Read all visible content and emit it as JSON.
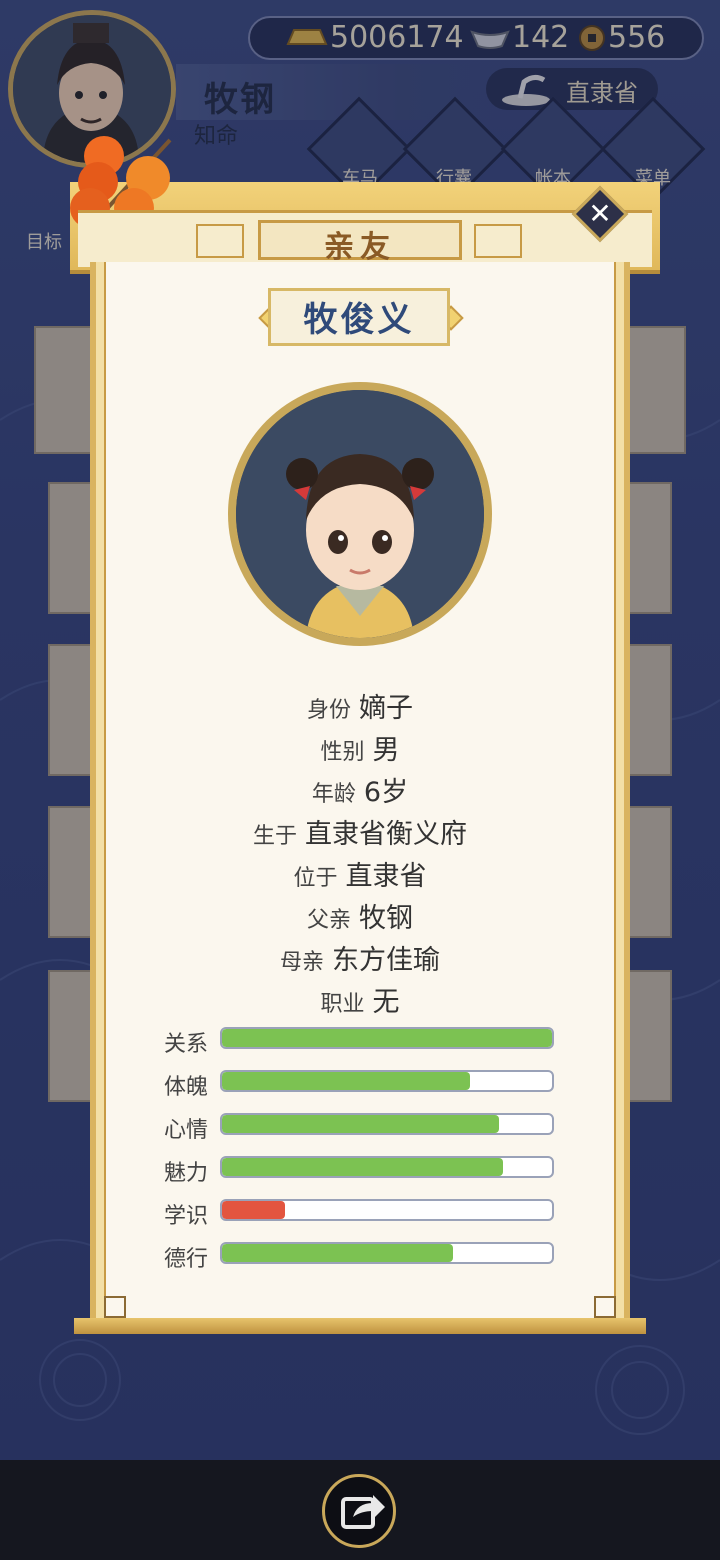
{
  "player": {
    "name": "牧钢",
    "title": "知命"
  },
  "currency": {
    "gold": "5006174",
    "silver": "142",
    "copper": "556"
  },
  "province": "直隶省",
  "menu": [
    {
      "label": "车马",
      "icon": "carriage-icon"
    },
    {
      "label": "行囊",
      "icon": "bag-icon"
    },
    {
      "label": "帐本",
      "icon": "ledger-icon"
    },
    {
      "label": "菜单",
      "icon": "more-icon"
    }
  ],
  "goal_label": "目标",
  "modal": {
    "title": "亲友",
    "child_name": "牧俊义",
    "info": [
      {
        "label": "身份",
        "value": "嫡子"
      },
      {
        "label": "性别",
        "value": "男"
      },
      {
        "label": "年龄",
        "value": "6岁"
      },
      {
        "label": "生于",
        "value": "直隶省衡义府"
      },
      {
        "label": "位于",
        "value": "直隶省"
      },
      {
        "label": "父亲",
        "value": "牧钢"
      },
      {
        "label": "母亲",
        "value": "东方佳瑜"
      },
      {
        "label": "职业",
        "value": "无"
      }
    ],
    "stats": [
      {
        "label": "关系",
        "fraction": 1.0,
        "color": "#7cc252"
      },
      {
        "label": "体魄",
        "fraction": 0.75,
        "color": "#7cc252"
      },
      {
        "label": "心情",
        "fraction": 0.84,
        "color": "#7cc252"
      },
      {
        "label": "魅力",
        "fraction": 0.85,
        "color": "#7cc252"
      },
      {
        "label": "学识",
        "fraction": 0.19,
        "color": "#e3553f"
      },
      {
        "label": "德行",
        "fraction": 0.7,
        "color": "#7cc252"
      }
    ]
  },
  "colors": {
    "bar_good": "#7cc252",
    "bar_low": "#e3553f",
    "gold_trim": "#c9a85a"
  }
}
